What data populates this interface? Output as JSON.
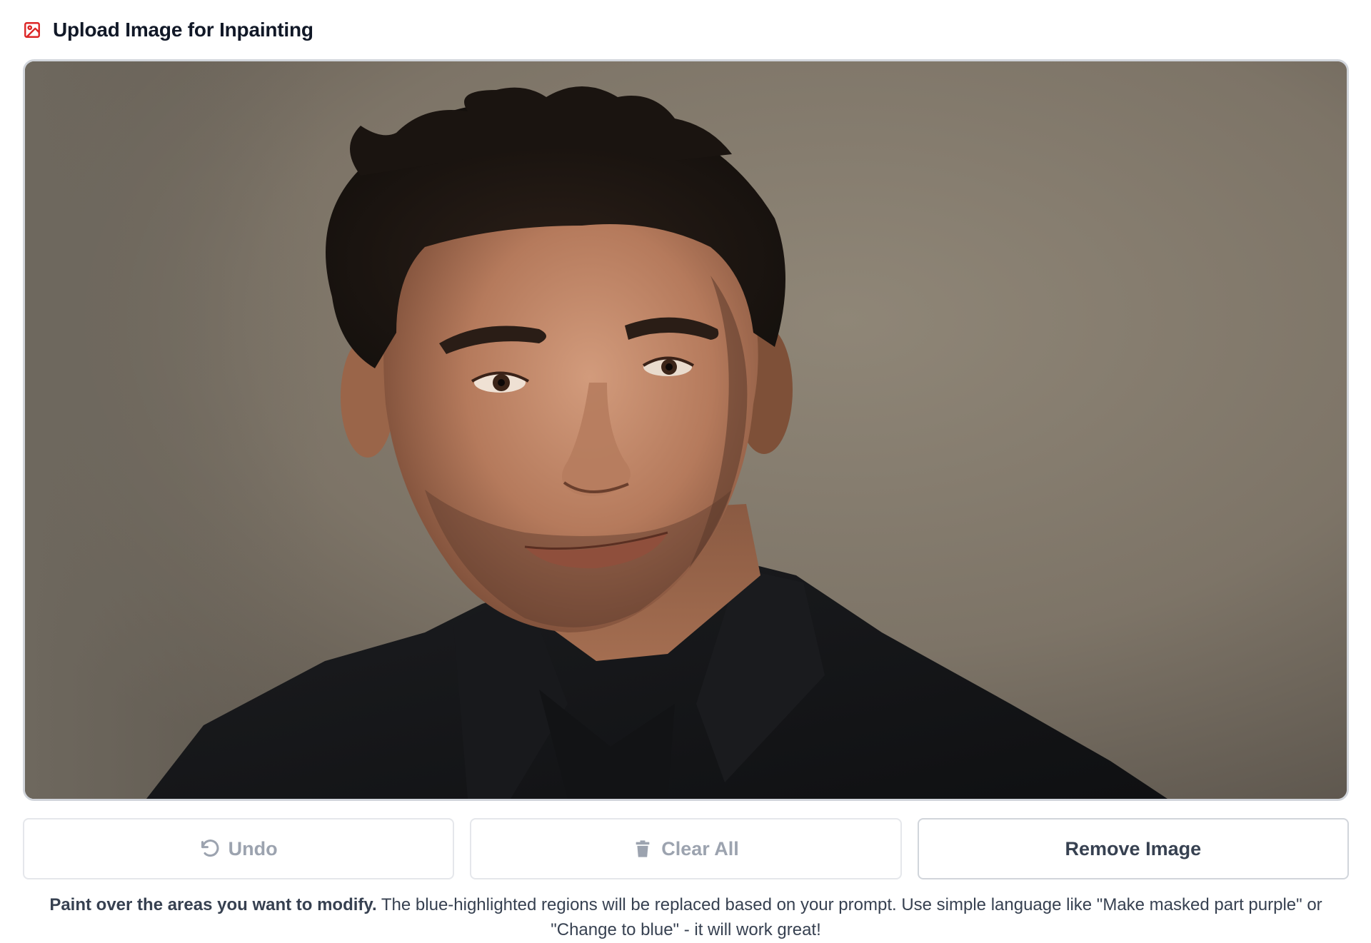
{
  "header": {
    "title": "Upload Image for Inpainting",
    "icon": "image-icon",
    "icon_color": "#dc2626"
  },
  "canvas": {
    "content": "uploaded-portrait-photo"
  },
  "buttons": {
    "undo": {
      "label": "Undo",
      "icon": "undo-icon",
      "enabled": false
    },
    "clear_all": {
      "label": "Clear All",
      "icon": "trash-icon",
      "enabled": false
    },
    "remove_image": {
      "label": "Remove Image",
      "enabled": true
    }
  },
  "hint": {
    "bold": "Paint over the areas you want to modify.",
    "text": " The blue-highlighted regions will be replaced based on your prompt. Use simple language like \"Make masked part purple\" or \"Change to blue\" - it will work great!"
  },
  "colors": {
    "accent": "#dc2626",
    "border": "#d1d5db",
    "disabled_text": "#9ca3af",
    "text": "#374151"
  }
}
